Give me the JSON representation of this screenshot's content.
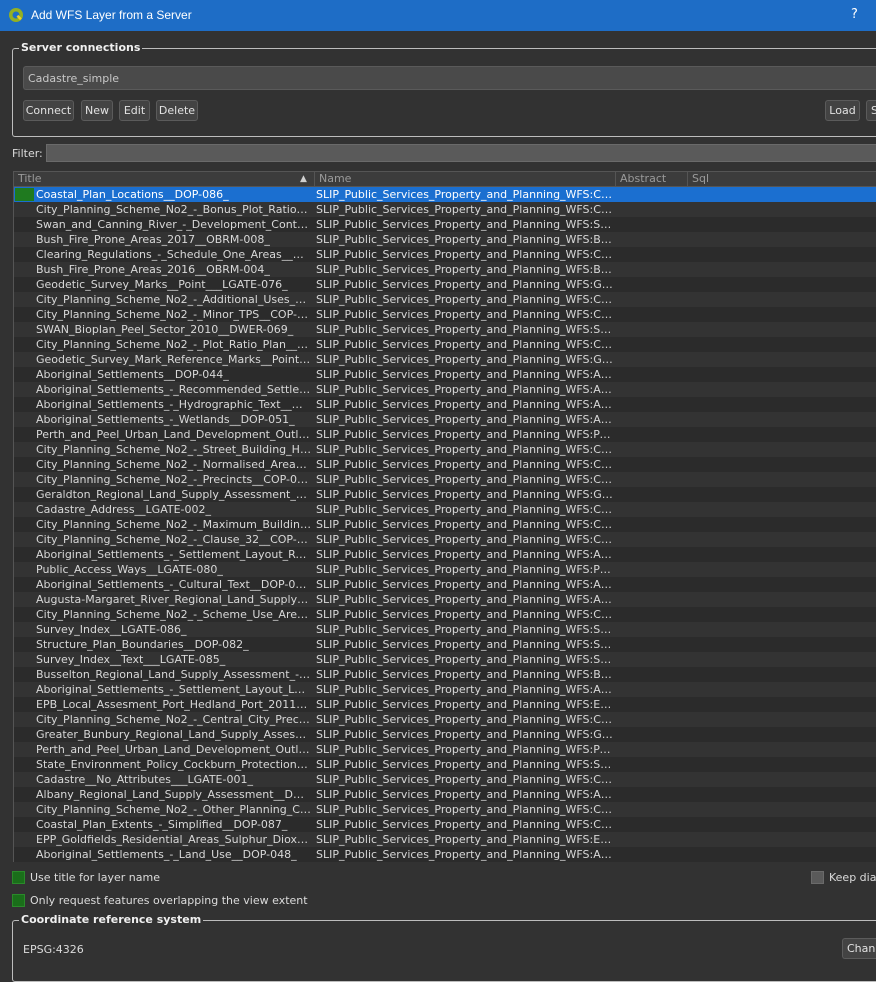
{
  "window": {
    "title": "Add WFS Layer from a Server",
    "help": "?"
  },
  "server_connections": {
    "legend": "Server connections",
    "selected": "Cadastre_simple",
    "buttons": {
      "connect": "Connect",
      "new": "New",
      "edit": "Edit",
      "delete": "Delete",
      "load": "Load",
      "save": "S"
    }
  },
  "filter": {
    "label": "Filter:",
    "value": ""
  },
  "table": {
    "columns": [
      "Title",
      "Name",
      "Abstract",
      "Sql"
    ],
    "rows": [
      {
        "title": "Coastal_Plan_Locations__DOP-086_",
        "name": "SLIP_Public_Services_Property_and_Planning_WFS:Coasta..."
      },
      {
        "title": "City_Planning_Scheme_No2_-_Bonus_Plot_Ratio_Plans...",
        "name": "SLIP_Public_Services_Property_and_Planning_WFS:City_Pl..."
      },
      {
        "title": "Swan_and_Canning_River_-_Development_Control_Ar...",
        "name": "SLIP_Public_Services_Property_and_Planning_WFS:Swan_..."
      },
      {
        "title": "Bush_Fire_Prone_Areas_2017__OBRM-008_",
        "name": "SLIP_Public_Services_Property_and_Planning_WFS:Bush_..."
      },
      {
        "title": "Clearing_Regulations_-_Schedule_One_Areas__DWER...",
        "name": "SLIP_Public_Services_Property_and_Planning_WFS:Clearin..."
      },
      {
        "title": "Bush_Fire_Prone_Areas_2016__OBRM-004_",
        "name": "SLIP_Public_Services_Property_and_Planning_WFS:Bush_..."
      },
      {
        "title": "Geodetic_Survey_Marks__Point___LGATE-076_",
        "name": "SLIP_Public_Services_Property_and_Planning_WFS:Geode..."
      },
      {
        "title": "City_Planning_Scheme_No2_-_Additional_Uses__COP-...",
        "name": "SLIP_Public_Services_Property_and_Planning_WFS:City_Pl..."
      },
      {
        "title": "City_Planning_Scheme_No2_-_Minor_TPS__COP-015_",
        "name": "SLIP_Public_Services_Property_and_Planning_WFS:City_Pl..."
      },
      {
        "title": "SWAN_Bioplan_Peel_Sector_2010__DWER-069_",
        "name": "SLIP_Public_Services_Property_and_Planning_WFS:SWAN..."
      },
      {
        "title": "City_Planning_Scheme_No2_-_Plot_Ratio_Plan__COP-...",
        "name": "SLIP_Public_Services_Property_and_Planning_WFS:City_Pl..."
      },
      {
        "title": "Geodetic_Survey_Mark_Reference_Marks__Point___L...",
        "name": "SLIP_Public_Services_Property_and_Planning_WFS:Geode..."
      },
      {
        "title": "Aboriginal_Settlements__DOP-044_",
        "name": "SLIP_Public_Services_Property_and_Planning_WFS:Aborigi..."
      },
      {
        "title": "Aboriginal_Settlements_-_Recommended_Settlement_...",
        "name": "SLIP_Public_Services_Property_and_Planning_WFS:Aborigi..."
      },
      {
        "title": "Aboriginal_Settlements_-_Hydrographic_Text__DOP-0...",
        "name": "SLIP_Public_Services_Property_and_Planning_WFS:Aborigi..."
      },
      {
        "title": "Aboriginal_Settlements_-_Wetlands__DOP-051_",
        "name": "SLIP_Public_Services_Property_and_Planning_WFS:Aborigi..."
      },
      {
        "title": "Perth_and_Peel_Urban_Land_Development_Outlook_2...",
        "name": "SLIP_Public_Services_Property_and_Planning_WFS:Perth_..."
      },
      {
        "title": "City_Planning_Scheme_No2_-_Street_Building_Height_...",
        "name": "SLIP_Public_Services_Property_and_Planning_WFS:City_Pl..."
      },
      {
        "title": "City_Planning_Scheme_No2_-_Normalised_Areas__CO...",
        "name": "SLIP_Public_Services_Property_and_Planning_WFS:City_Pl..."
      },
      {
        "title": "City_Planning_Scheme_No2_-_Precincts__COP-018_",
        "name": "SLIP_Public_Services_Property_and_Planning_WFS:City_Pl..."
      },
      {
        "title": "Geraldton_Regional_Land_Supply_Assessment_2017_...",
        "name": "SLIP_Public_Services_Property_and_Planning_WFS:Gerald..."
      },
      {
        "title": "Cadastre_Address__LGATE-002_",
        "name": "SLIP_Public_Services_Property_and_Planning_WFS:Cadast..."
      },
      {
        "title": "City_Planning_Scheme_No2_-_Maximum_Building_Heig...",
        "name": "SLIP_Public_Services_Property_and_Planning_WFS:City_Pl..."
      },
      {
        "title": "City_Planning_Scheme_No2_-_Clause_32__COP-014_",
        "name": "SLIP_Public_Services_Property_and_Planning_WFS:City_Pl..."
      },
      {
        "title": "Aboriginal_Settlements_-_Settlement_Layout_Road_N...",
        "name": "SLIP_Public_Services_Property_and_Planning_WFS:Aborigi..."
      },
      {
        "title": "Public_Access_Ways__LGATE-080_",
        "name": "SLIP_Public_Services_Property_and_Planning_WFS:Public_..."
      },
      {
        "title": "Aboriginal_Settlements_-_Cultural_Text__DOP-049_",
        "name": "SLIP_Public_Services_Property_and_Planning_WFS:Aborigi..."
      },
      {
        "title": "Augusta-Margaret_River_Regional_Land_Supply_Asse...",
        "name": "SLIP_Public_Services_Property_and_Planning_WFS:August..."
      },
      {
        "title": "City_Planning_Scheme_No2_-_Scheme_Use_Areas__C...",
        "name": "SLIP_Public_Services_Property_and_Planning_WFS:City_Pl..."
      },
      {
        "title": "Survey_Index__LGATE-086_",
        "name": "SLIP_Public_Services_Property_and_Planning_WFS:Survey..."
      },
      {
        "title": "Structure_Plan_Boundaries__DOP-082_",
        "name": "SLIP_Public_Services_Property_and_Planning_WFS:Struct..."
      },
      {
        "title": "Survey_Index__Text___LGATE-085_",
        "name": "SLIP_Public_Services_Property_and_Planning_WFS:Survey..."
      },
      {
        "title": "Busselton_Regional_Land_Supply_Assessment_-_Futu...",
        "name": "SLIP_Public_Services_Property_and_Planning_WFS:Busselt..."
      },
      {
        "title": "Aboriginal_Settlements_-_Settlement_Layout_Lots__D...",
        "name": "SLIP_Public_Services_Property_and_Planning_WFS:Aborigi..."
      },
      {
        "title": "EPB_Local_Assesment_Port_Hedland_Port_2011__DW...",
        "name": "SLIP_Public_Services_Property_and_Planning_WFS:EPB_L..."
      },
      {
        "title": "City_Planning_Scheme_No2_-_Central_City_Precincts_...",
        "name": "SLIP_Public_Services_Property_and_Planning_WFS:City_Pl..."
      },
      {
        "title": "Greater_Bunbury_Regional_Land_Supply_Assessment...",
        "name": "SLIP_Public_Services_Property_and_Planning_WFS:Greate..."
      },
      {
        "title": "Perth_and_Peel_Urban_Land_Development_Outlook_2...",
        "name": "SLIP_Public_Services_Property_and_Planning_WFS:Perth_..."
      },
      {
        "title": "State_Environment_Policy_Cockburn_Protection_Level...",
        "name": "SLIP_Public_Services_Property_and_Planning_WFS:State_..."
      },
      {
        "title": "Cadastre__No_Attributes___LGATE-001_",
        "name": "SLIP_Public_Services_Property_and_Planning_WFS:Cadast..."
      },
      {
        "title": "Albany_Regional_Land_Supply_Assessment__DOP-084_",
        "name": "SLIP_Public_Services_Property_and_Planning_WFS:Albany..."
      },
      {
        "title": "City_Planning_Scheme_No2_-_Other_Planning_Control...",
        "name": "SLIP_Public_Services_Property_and_Planning_WFS:City_Pl..."
      },
      {
        "title": "Coastal_Plan_Extents_-_Simplified__DOP-087_",
        "name": "SLIP_Public_Services_Property_and_Planning_WFS:Coasta..."
      },
      {
        "title": "EPP_Goldfields_Residential_Areas_Sulphur_Dioxide_20...",
        "name": "SLIP_Public_Services_Property_and_Planning_WFS:EPP_G..."
      },
      {
        "title": "Aboriginal_Settlements_-_Land_Use__DOP-048_",
        "name": "SLIP_Public_Services_Property_and_Planning_WFS:Aborigi..."
      }
    ]
  },
  "options": {
    "use_title": "Use title for layer name",
    "keep_dialog": "Keep dialo",
    "only_request": "Only request features overlapping the view extent"
  },
  "crs": {
    "legend": "Coordinate reference system",
    "value": "EPSG:4326",
    "change": "Chang"
  },
  "colors": {
    "titlebar": "#1e6dc6",
    "selection": "#1b6fd0",
    "checked": "#1a6e1a"
  }
}
